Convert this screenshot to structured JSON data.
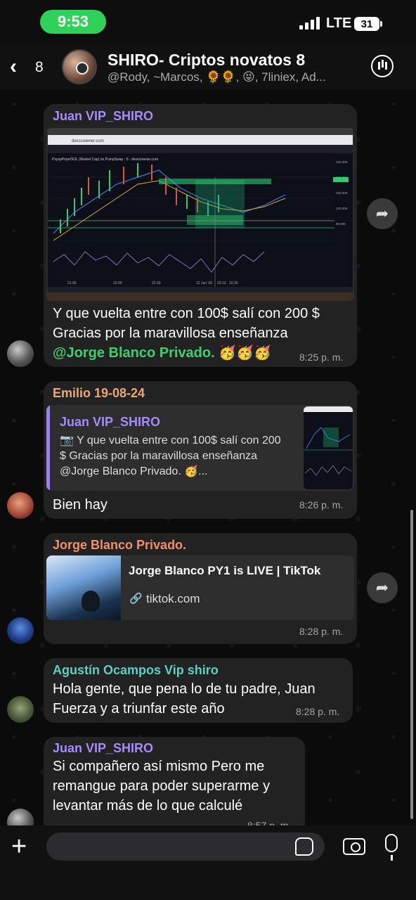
{
  "status_bar": {
    "time": "9:53",
    "network": "LTE",
    "battery": "31"
  },
  "header": {
    "back_icon": "chevron-left-icon",
    "back_count": "8",
    "title": "SHIRO-  Criptos novatos 8",
    "members": "@Rody, ~Marcos, 🌻🌻, 😝, 7liniex, Ad..."
  },
  "messages": [
    {
      "sender": "Juan VIP_SHIRO",
      "sender_color": "#a78bfa",
      "line1": "Y que vuelta entre con 100$ salí con 200 $",
      "line2": "Gracias por la maravillosa enseñanza",
      "mention": "@Jorge Blanco Privado.",
      "emojis": "🥳🥳🥳",
      "time": "8:25 p. m.",
      "chart_screen": {
        "url_bar": "dexscreener.com",
        "pair_label": "PsyopPepe/SOL (Market Cap) on PumpSwap · 5 · dexscreener.com",
        "axis_times": [
          "21:30",
          "22:00",
          "22:30",
          "12 Jan '26",
          "23:13",
          "23:30"
        ],
        "price_labels": [
          "220.00K",
          "200.00K",
          "180.00K",
          "160.00K",
          "140.00K",
          "120.00K",
          "100.00K",
          "80.00K",
          "60.00K"
        ]
      }
    },
    {
      "sender": "Emilio 19-08-24",
      "sender_color": "#e8a87c",
      "reply_sender": "Juan VIP_SHIRO",
      "reply_text": "📷 Y que vuelta entre con 100$ salí con 200 $ Gracias por la maravillosa enseñanza @Jorge Blanco Privado. 🥳...",
      "text": "Bien hay",
      "time": "8:26 p. m."
    },
    {
      "sender": "Jorge Blanco Privado.",
      "sender_color": "#f0916b",
      "link_title": "Jorge Blanco PY1 is LIVE | TikTok",
      "link_domain": "tiktok.com",
      "time": "8:28 p. m."
    },
    {
      "sender": "Agustín Ocampos Vip shiro",
      "sender_color": "#5ad1c3",
      "line1": "Hola gente, que pena lo de tu padre, Juan",
      "line2": "Fuerza y a triunfar este año",
      "time": "8:28 p. m."
    },
    {
      "sender": "Juan VIP_SHIRO",
      "sender_color": "#a78bfa",
      "line1": "Si compañero así mismo Pero me",
      "line2": "remangue para poder superarme y",
      "line3": "levantar más de lo que calculé",
      "time": "8:57 p. m."
    }
  ],
  "composer": {
    "placeholder": ""
  },
  "icons": {
    "forward": "forward-icon",
    "plus": "plus-icon",
    "sticker": "sticker-icon",
    "camera": "camera-icon",
    "mic": "mic-icon",
    "link": "link-icon"
  }
}
